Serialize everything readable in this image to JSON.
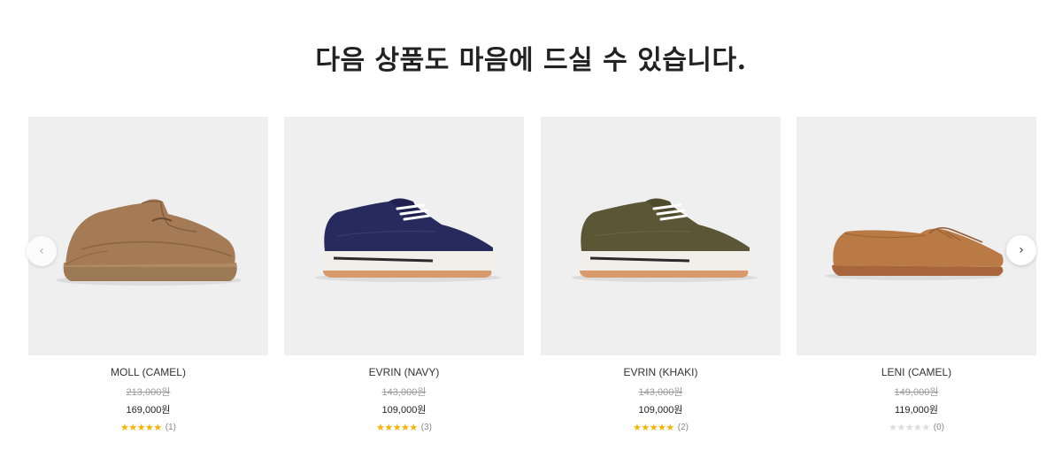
{
  "section": {
    "title": "다음 상품도 마음에 드실 수 있습니다."
  },
  "carousel": {
    "prev_icon": "‹",
    "next_icon": "›",
    "products": [
      {
        "name": "MOLL (CAMEL)",
        "original_price": "213,000원",
        "price": "169,000원",
        "rating": 5,
        "stars": "★★★★★",
        "review_count": "(1)",
        "image": "camel-wallabee-shoe"
      },
      {
        "name": "EVRIN (NAVY)",
        "original_price": "143,000원",
        "price": "109,000원",
        "rating": 5,
        "stars": "★★★★★",
        "review_count": "(3)",
        "image": "navy-platform-sneaker"
      },
      {
        "name": "EVRIN (KHAKI)",
        "original_price": "143,000원",
        "price": "109,000원",
        "rating": 5,
        "stars": "★★★★★",
        "review_count": "(2)",
        "image": "khaki-platform-sneaker"
      },
      {
        "name": "LENI (CAMEL)",
        "original_price": "149,000원",
        "price": "119,000원",
        "rating": 0,
        "stars": "★★★★★",
        "review_count": "(0)",
        "image": "camel-suede-loafer"
      }
    ]
  },
  "colors": {
    "star_filled": "#f4b400",
    "star_empty": "#dcdcdc",
    "thumb_bg": "#efefef"
  }
}
